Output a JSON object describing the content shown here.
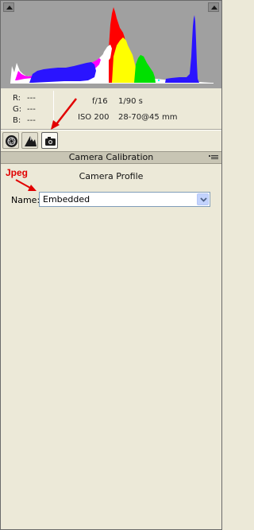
{
  "histogram": {
    "channel_colors": {
      "luminance": "#ffffff",
      "red": "#ff0000",
      "green": "#00e000",
      "blue": "#2a14ff",
      "yellow": "#ffff00",
      "magenta": "#ff00ff",
      "cyan": "#00ffff"
    }
  },
  "readout": {
    "r_label": "R:",
    "r_value": "---",
    "g_label": "G:",
    "g_value": "---",
    "b_label": "B:",
    "b_value": "---"
  },
  "exif": {
    "aperture": "f/16",
    "shutter": "1/90 s",
    "iso": "ISO 200",
    "lens": "28-70@45 mm"
  },
  "tabs": [
    {
      "icon": "aperture-icon",
      "active": false
    },
    {
      "icon": "mountain-icon",
      "active": false
    },
    {
      "icon": "camera-icon",
      "active": true
    }
  ],
  "section": {
    "title": "Camera Calibration",
    "menu_icon": "panel-menu-icon"
  },
  "camera_profile": {
    "heading": "Camera Profile",
    "name_label": "Name:",
    "selected": "Embedded"
  },
  "annotation": {
    "label": "Jpeg",
    "color": "#e10000"
  }
}
